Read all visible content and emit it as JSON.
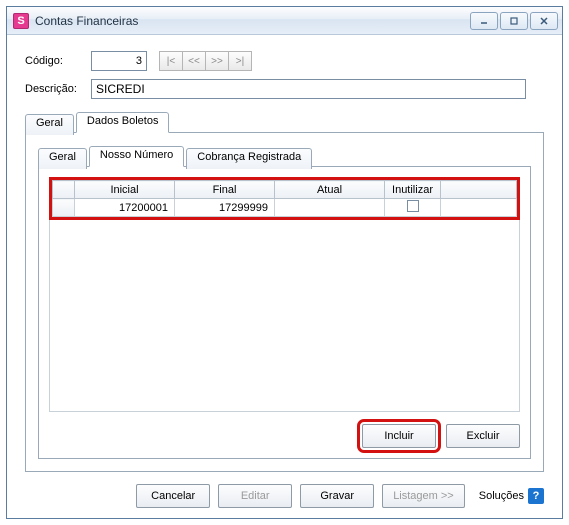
{
  "window": {
    "title": "Contas Financeiras",
    "appicon_glyph": "S"
  },
  "form": {
    "codigo_label": "Código:",
    "codigo_value": "3",
    "descricao_label": "Descrição:",
    "descricao_value": "SICREDI"
  },
  "nav": {
    "first": "|<",
    "prev": "<<",
    "next": ">>",
    "last": ">|"
  },
  "outer_tabs": {
    "geral": "Geral",
    "dados_boletos": "Dados Boletos"
  },
  "inner_tabs": {
    "geral": "Geral",
    "nosso_numero": "Nosso Número",
    "cobranca": "Cobrança Registrada"
  },
  "grid": {
    "headers": {
      "inicial": "Inicial",
      "final": "Final",
      "atual": "Atual",
      "inutilizar": "Inutilizar"
    },
    "rows": [
      {
        "inicial": "17200001",
        "final": "17299999",
        "atual": "",
        "inutilizar": false
      }
    ]
  },
  "actions": {
    "incluir": "Incluir",
    "excluir": "Excluir"
  },
  "bottom": {
    "cancelar": "Cancelar",
    "editar": "Editar",
    "gravar": "Gravar",
    "listagem": "Listagem >>",
    "solucoes": "Soluções",
    "help_glyph": "?"
  }
}
